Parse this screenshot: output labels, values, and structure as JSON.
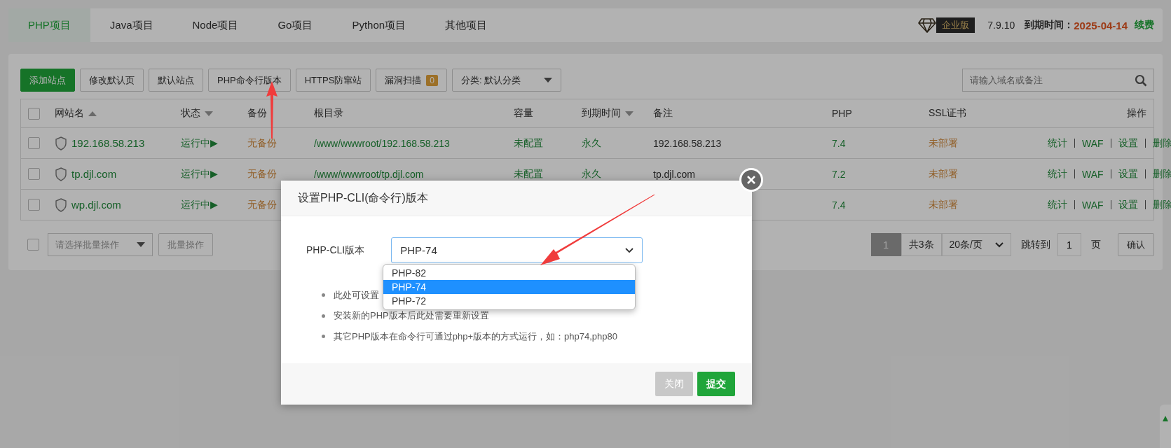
{
  "tabs": [
    {
      "label": "PHP项目",
      "selected": true
    },
    {
      "label": "Java项目",
      "selected": false
    },
    {
      "label": "Node项目",
      "selected": false
    },
    {
      "label": "Go项目",
      "selected": false
    },
    {
      "label": "Python项目",
      "selected": false
    },
    {
      "label": "其他项目",
      "selected": false
    }
  ],
  "edition": {
    "badge": "企业版",
    "version": "7.9.10",
    "expiry_label": "到期时间：",
    "expiry_date": "2025-04-14",
    "renew": "续费"
  },
  "toolbar": {
    "buttons": [
      {
        "label": "添加站点",
        "kind": "primary"
      },
      {
        "label": "修改默认页",
        "kind": "default"
      },
      {
        "label": "默认站点",
        "kind": "default"
      },
      {
        "label": "PHP命令行版本",
        "kind": "default"
      },
      {
        "label": "HTTPS防窜站",
        "kind": "default"
      }
    ],
    "scan": {
      "label": "漏洞扫描",
      "count": "0"
    },
    "category": "分类: 默认分类",
    "search": {
      "placeholder": "请输入域名或备注"
    }
  },
  "table": {
    "all_checked": false,
    "columns": [
      {
        "label": "网站名",
        "sortable": true,
        "ascending": true
      },
      {
        "label": "状态",
        "sortable": true,
        "ascending": false
      },
      {
        "label": "备份",
        "sortable": false
      },
      {
        "label": "根目录",
        "sortable": false
      },
      {
        "label": "容量",
        "sortable": false
      },
      {
        "label": "到期时间",
        "sortable": true,
        "ascending": false
      },
      {
        "label": "备注",
        "sortable": false
      },
      {
        "label": "PHP",
        "sortable": false
      },
      {
        "label": "SSL证书",
        "sortable": false
      },
      {
        "label": "操作",
        "sortable": false
      }
    ],
    "rows": [
      {
        "checked": false,
        "name": "192.168.58.213",
        "status": "运行中▶",
        "backup": "无备份",
        "root": "/www/wwwroot/192.168.58.213",
        "capacity": "未配置",
        "expiry": "永久",
        "remark": "192.168.58.213",
        "php": "7.4",
        "ssl": "未部署",
        "actions": [
          "统计",
          "WAF",
          "设置",
          "删除"
        ]
      },
      {
        "checked": false,
        "name": "tp.djl.com",
        "status": "运行中▶",
        "backup": "无备份",
        "root": "/www/wwwroot/tp.djl.com",
        "capacity": "未配置",
        "expiry": "永久",
        "remark": "tp.djl.com",
        "php": "7.2",
        "ssl": "未部署",
        "actions": [
          "统计",
          "WAF",
          "设置",
          "删除"
        ]
      },
      {
        "checked": false,
        "name": "wp.djl.com",
        "status": "运行中▶",
        "backup": "无备份",
        "php": "7.4",
        "ssl": "未部署",
        "actions": [
          "统计",
          "WAF",
          "设置",
          "删除"
        ]
      }
    ]
  },
  "footer": {
    "batch_checked": false,
    "batch_placeholder": "请选择批量操作",
    "batch_button": "批量操作",
    "page": "1",
    "total": "共3条",
    "page_size": "20条/页",
    "jump_label": "跳转到",
    "jump_value": "1",
    "page_unit": "页",
    "confirm": "确认"
  },
  "dialog": {
    "title": "设置PHP-CLI(命令行)版本",
    "field_label": "PHP-CLI版本",
    "value": "PHP-74",
    "options": [
      {
        "label": "PHP-82",
        "selected": false
      },
      {
        "label": "PHP-74",
        "selected": true
      },
      {
        "label": "PHP-72",
        "selected": false
      }
    ],
    "notes": [
      "此处可设置",
      "安装新的PHP版本后此处需要重新设置",
      "其它PHP版本在命令行可通过php+版本的方式运行，如：php74,php80"
    ],
    "buttons": [
      {
        "label": "关闭",
        "kind": "disabled"
      },
      {
        "label": "提交",
        "kind": "primary"
      }
    ]
  }
}
